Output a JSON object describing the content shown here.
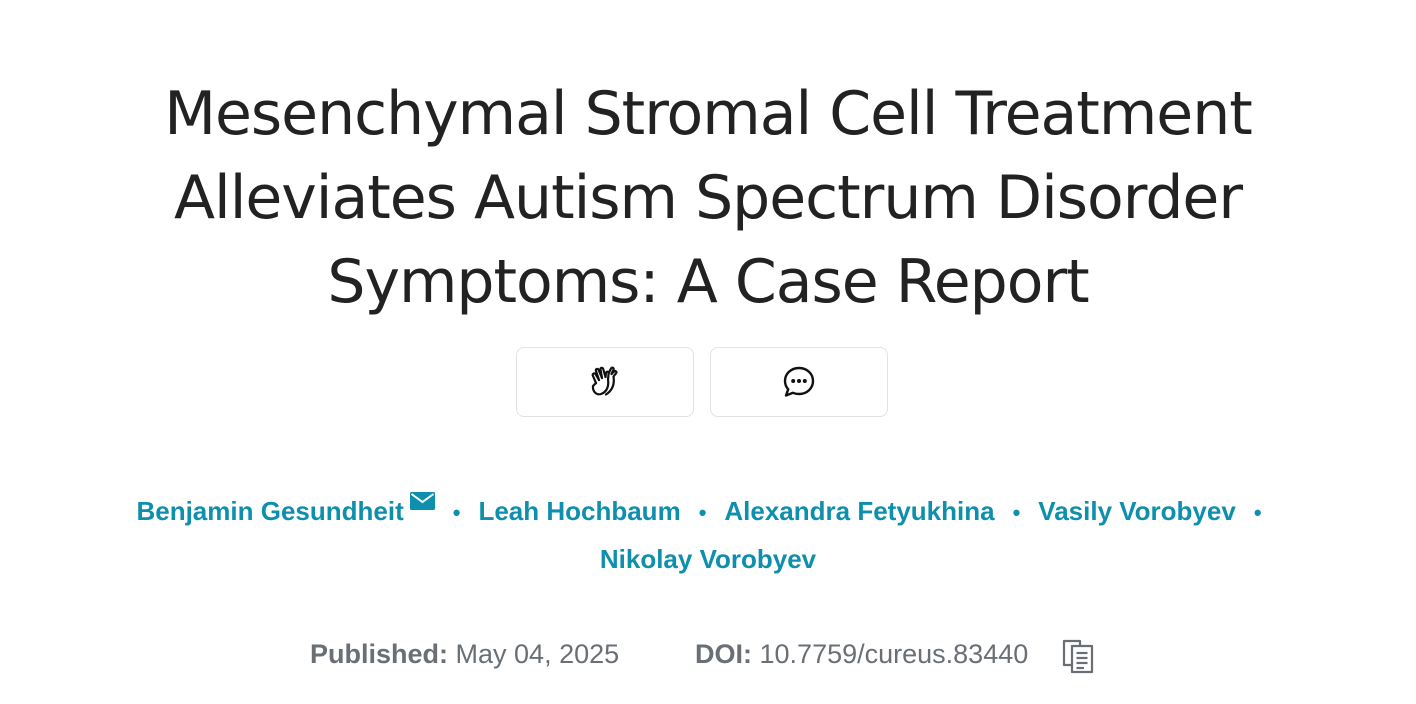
{
  "article": {
    "title": "Mesenchymal Stromal Cell Treatment Alleviates Autism Spectrum Disorder Symptoms: A Case Report",
    "actions": [
      {
        "icon": "clap-icon"
      },
      {
        "icon": "comment-icon"
      }
    ],
    "authors": [
      {
        "name": "Benjamin Gesundheit",
        "corresponding": true
      },
      {
        "name": "Leah Hochbaum"
      },
      {
        "name": "Alexandra Fetyukhina"
      },
      {
        "name": "Vasily Vorobyev"
      },
      {
        "name": "Nikolay Vorobyev"
      }
    ],
    "separator": "•",
    "published_label": "Published:",
    "published_date": "May 04, 2025",
    "doi_label": "DOI:",
    "doi_value": "10.7759/cureus.83440"
  },
  "colors": {
    "author_link": "#0f8fae",
    "title_text": "#222222",
    "meta_text": "#6a6f75"
  }
}
